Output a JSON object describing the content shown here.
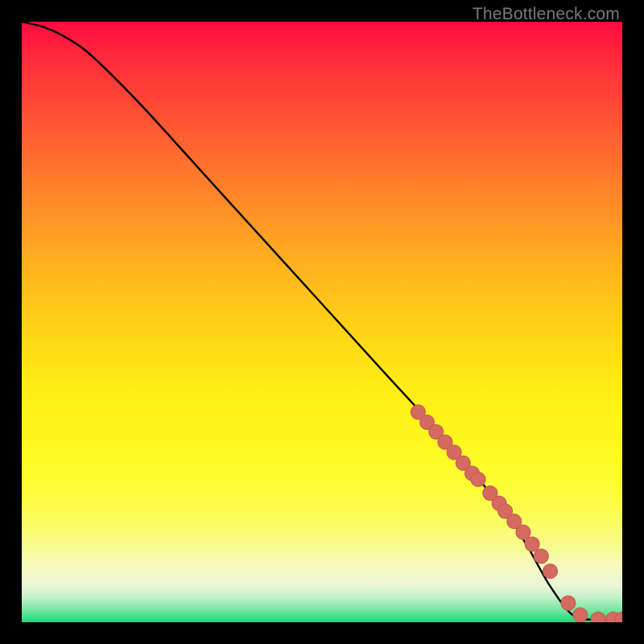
{
  "attribution": "TheBottleneck.com",
  "colors": {
    "frame": "#000000",
    "curve": "#000000",
    "marker_fill": "#d46a60",
    "marker_stroke": "#c45a52",
    "gradient_top": "#ff0b3f",
    "gradient_bottom": "#1fd777"
  },
  "chart_data": {
    "type": "line",
    "title": "",
    "xlabel": "",
    "ylabel": "",
    "xlim": [
      0,
      100
    ],
    "ylim": [
      0,
      100
    ],
    "grid": false,
    "curve": {
      "x": [
        0,
        4,
        8,
        12,
        20,
        30,
        40,
        50,
        60,
        70,
        80,
        84,
        88,
        92,
        96,
        100
      ],
      "y": [
        100,
        99,
        97,
        94,
        86,
        75,
        64,
        53,
        42,
        31,
        19,
        13,
        6,
        1,
        0.5,
        0.5
      ]
    },
    "series": [
      {
        "name": "markers",
        "x": [
          66,
          67.5,
          69,
          70.5,
          72,
          73.5,
          75,
          76,
          78,
          79.5,
          80.5,
          82,
          83.5,
          85,
          86.5,
          88,
          91,
          93,
          96,
          98.5,
          100
        ],
        "y": [
          35,
          33.3,
          31.7,
          30,
          28.3,
          26.5,
          24.8,
          23.8,
          21.5,
          19.8,
          18.5,
          16.8,
          15,
          13,
          11,
          8.5,
          3.2,
          1.2,
          0.5,
          0.5,
          0.5
        ]
      }
    ]
  }
}
